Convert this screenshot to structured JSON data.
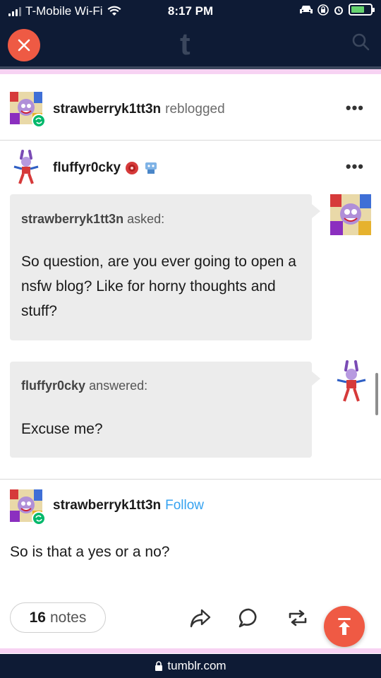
{
  "status_bar": {
    "carrier": "T-Mobile Wi-Fi",
    "time": "8:17 PM"
  },
  "header": {
    "logo": "t",
    "close_icon": "close-icon",
    "search_icon": "search-icon"
  },
  "reblog_header": {
    "username": "strawberryk1tt3n",
    "action": "reblogged",
    "more": "•••"
  },
  "original_post": {
    "username": "fluffyr0cky",
    "more": "•••",
    "ask": {
      "asker": "strawberryk1tt3n",
      "asked_label": "asked:",
      "question": "So question, are you ever going to open a nsfw blog? Like for horny thoughts and stuff?"
    },
    "answer": {
      "answerer": "fluffyr0cky",
      "answered_label": "answered:",
      "text": "Excuse me?"
    }
  },
  "reblog_post": {
    "username": "strawberryk1tt3n",
    "follow_label": "Follow",
    "body": "So is that a yes or a no?"
  },
  "footer": {
    "notes_count": "16",
    "notes_label": "notes",
    "url": "tumblr.com"
  },
  "colors": {
    "navy": "#0e1b35",
    "accent_red": "#ef5a44",
    "follow_blue": "#35a2f0",
    "pink_strip": "#f7d3f3"
  }
}
